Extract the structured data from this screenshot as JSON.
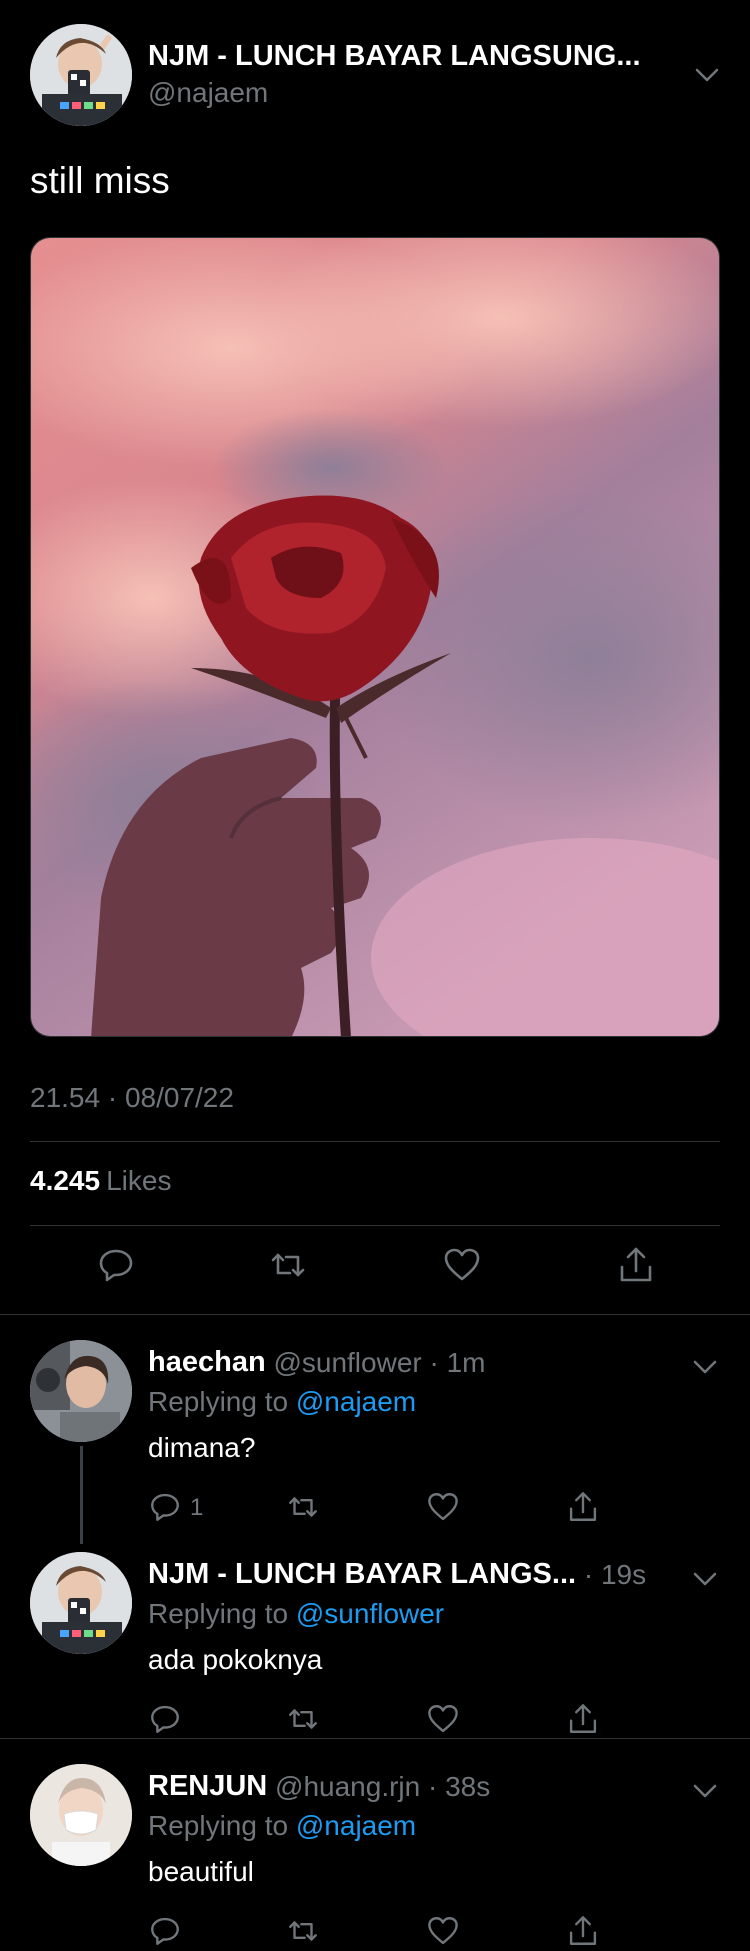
{
  "main_tweet": {
    "author_name": "NJM - LUNCH BAYAR LANGSUNG...",
    "author_handle": "@najaem",
    "text": "still miss",
    "timestamp": "21.54 · 08/07/22",
    "likes_count": "4.245",
    "likes_label": "Likes",
    "icons": [
      "reply-icon",
      "retweet-icon",
      "like-icon",
      "share-icon"
    ]
  },
  "replies": [
    {
      "name": "haechan",
      "handle": "@sunflower",
      "time": " · 1m",
      "replying_prefix": "Replying to ",
      "replying_to": "@najaem",
      "text": "dimana?",
      "reply_count": "1"
    },
    {
      "name": "NJM - LUNCH BAYAR LANGS...",
      "handle": "",
      "time": " · 19s",
      "replying_prefix": "Replying to ",
      "replying_to": "@sunflower",
      "text": "ada pokoknya",
      "reply_count": ""
    },
    {
      "name": "RENJUN",
      "handle": "@huang.rjn",
      "time": " · 38s",
      "replying_prefix": "Replying to ",
      "replying_to": "@najaem",
      "text": "beautiful",
      "reply_count": ""
    }
  ],
  "colors": {
    "background": "#000000",
    "text_primary": "#ffffff",
    "text_secondary": "#71767b",
    "accent": "#1d9bf0",
    "divider": "#2f3336"
  }
}
